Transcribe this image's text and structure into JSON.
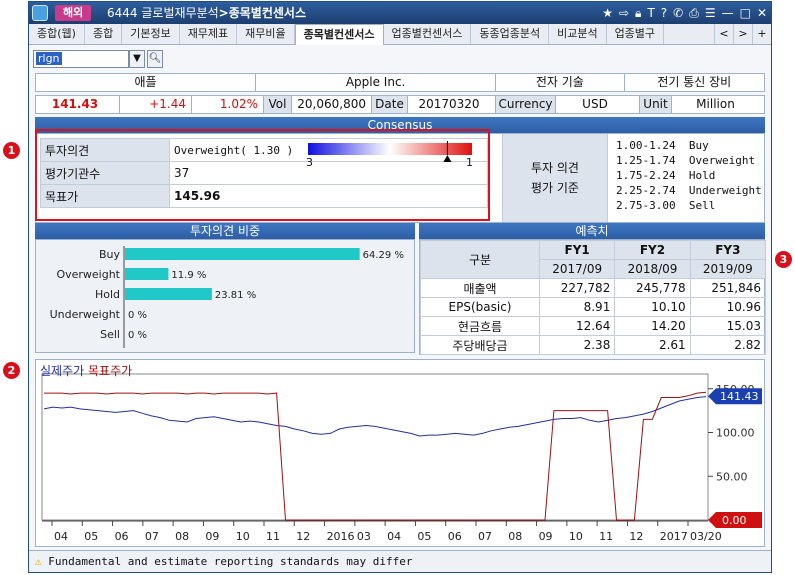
{
  "title": {
    "badge": "해외",
    "code": "6444",
    "path": "글로벌재무분석",
    "sep": ">",
    "screen": "종목별컨센서스"
  },
  "tabs": [
    "종합(웹)",
    "종합",
    "기본정보",
    "재무제표",
    "재무비율",
    "종목별컨센서스",
    "업종별컨센서스",
    "동종업종분석",
    "비교분석",
    "업종별구"
  ],
  "tab_nav": [
    "<",
    ">",
    "+"
  ],
  "search": {
    "value": "rlgn"
  },
  "info1": [
    "애플",
    "Apple Inc.",
    "전자 기술",
    "전기 통신 장비"
  ],
  "info2": {
    "price": "141.43",
    "change": "+1.44",
    "pct": "1.02%",
    "vol_label": "Vol",
    "vol": "20,060,800",
    "date_label": "Date",
    "date": "20170320",
    "cur_label": "Currency",
    "cur": "USD",
    "unit_label": "Unit",
    "unit": "Million"
  },
  "consensus": {
    "header": "Consensus",
    "rows": [
      {
        "label": "투자의견",
        "value": "Overweight( 1.30 )"
      },
      {
        "label": "평가기관수",
        "value": "37"
      },
      {
        "label": "목표가",
        "value": "145.96"
      }
    ],
    "scale_min": "3",
    "scale_max": "1",
    "opinion_score": 1.3,
    "legend_label": [
      "투자 의견",
      "평가 기준"
    ],
    "legend": [
      {
        "range": "1.00-1.24",
        "name": "Buy"
      },
      {
        "range": "1.25-1.74",
        "name": "Overweight"
      },
      {
        "range": "1.75-2.24",
        "name": "Hold"
      },
      {
        "range": "2.25-2.74",
        "name": "Underweight"
      },
      {
        "range": "2.75-3.00",
        "name": "Sell"
      }
    ]
  },
  "markers": [
    "1",
    "2",
    "3"
  ],
  "ratio": {
    "header": "투자의견 비중",
    "items": [
      {
        "name": "Buy",
        "pct": 64.29,
        "label": "64.29 %"
      },
      {
        "name": "Overweight",
        "pct": 11.9,
        "label": "11.9 %"
      },
      {
        "name": "Hold",
        "pct": 23.81,
        "label": "23.81 %"
      },
      {
        "name": "Underweight",
        "pct": 0,
        "label": "0 %"
      },
      {
        "name": "Sell",
        "pct": 0,
        "label": "0 %"
      }
    ]
  },
  "forecast": {
    "header": "예측치",
    "col_label": "구분",
    "years": [
      {
        "fy": "FY1",
        "ym": "2017/09"
      },
      {
        "fy": "FY2",
        "ym": "2018/09"
      },
      {
        "fy": "FY3",
        "ym": "2019/09"
      }
    ],
    "rows": [
      {
        "name": "매출액",
        "v": [
          "227,782",
          "245,778",
          "251,846"
        ]
      },
      {
        "name": "EPS(basic)",
        "v": [
          "8.91",
          "10.10",
          "10.96"
        ]
      },
      {
        "name": "현금흐름",
        "v": [
          "12.64",
          "14.20",
          "15.03"
        ]
      },
      {
        "name": "주당배당금",
        "v": [
          "2.38",
          "2.61",
          "2.82"
        ]
      }
    ]
  },
  "chart_data": {
    "type": "line",
    "legend": [
      {
        "name": "실제주가",
        "color": "#2030a0"
      },
      {
        "name": "목표주가",
        "color": "#a01010"
      }
    ],
    "y_ticks": [
      "150.00",
      "100.00",
      "50.00"
    ],
    "ylim": [
      0,
      160
    ],
    "last_price": "141.43",
    "zero_label": "0.00",
    "x_ticks": [
      "04",
      "05",
      "06",
      "07",
      "08",
      "09",
      "10",
      "11",
      "12",
      "2016",
      "03",
      "04",
      "05",
      "06",
      "07",
      "08",
      "09",
      "10",
      "11",
      "12",
      "2017",
      "03/20"
    ],
    "series": [
      {
        "name": "실제주가",
        "color": "#2030a0",
        "values": [
          127,
          129,
          128,
          129,
          127,
          126,
          125,
          124,
          123,
          124,
          125,
          122,
          119,
          117,
          114,
          113,
          112,
          116,
          117,
          118,
          116,
          114,
          112,
          113,
          112,
          110,
          108,
          107,
          104,
          102,
          99,
          98,
          99,
          104,
          106,
          107,
          108,
          107,
          105,
          103,
          101,
          99,
          96,
          97,
          97,
          98,
          99,
          98,
          97,
          99,
          102,
          104,
          106,
          107,
          109,
          111,
          113,
          115,
          116,
          116,
          117,
          114,
          112,
          114,
          116,
          117,
          119,
          121,
          124,
          128,
          132,
          136,
          138,
          140,
          141
        ]
      },
      {
        "name": "목표주가",
        "color": "#a01010",
        "values": [
          145,
          145,
          145,
          144,
          145,
          145,
          145,
          144,
          145,
          145,
          145,
          144,
          145,
          145,
          145,
          145,
          144,
          145,
          145,
          144,
          145,
          145,
          145,
          145,
          145,
          144,
          145,
          0,
          0,
          0,
          0,
          0,
          0,
          0,
          0,
          0,
          0,
          0,
          0,
          0,
          0,
          0,
          0,
          0,
          0,
          0,
          0,
          0,
          0,
          0,
          0,
          0,
          0,
          0,
          0,
          0,
          0,
          125,
          125,
          125,
          125,
          125,
          125,
          125,
          0,
          0,
          0,
          115,
          115,
          140,
          140,
          140,
          142,
          145,
          146
        ]
      }
    ]
  },
  "footer": {
    "icon": "warning-icon",
    "text": "Fundamental and estimate reporting standards may differ"
  }
}
